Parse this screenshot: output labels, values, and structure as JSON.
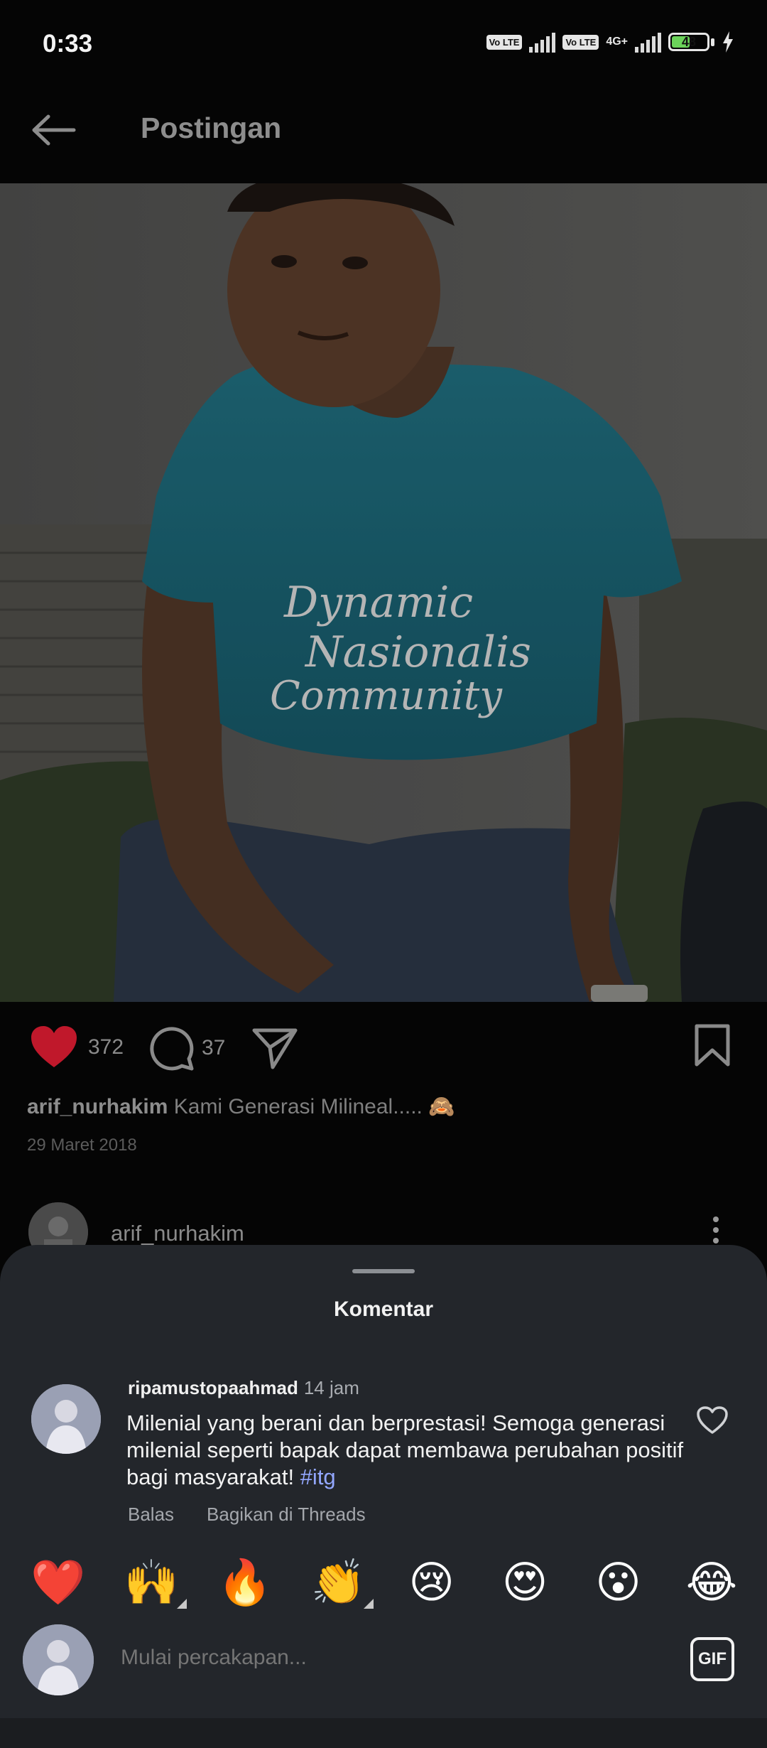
{
  "status_bar": {
    "time": "0:33",
    "volte_1": "Vo LTE",
    "volte_2": "Vo LTE",
    "network": "4G+",
    "battery": "48"
  },
  "header": {
    "title": "Postingan",
    "back_icon": "back-arrow-icon"
  },
  "post": {
    "photo_print_line1": "Dynamic",
    "photo_print_line2": "Nasionalis",
    "photo_print_line3": "Community",
    "likes": "372",
    "comments": "37",
    "caption_user": "arif_nurhakim",
    "caption_text": "Kami Generasi Milineal..... 🙈",
    "date": "29 Maret 2018",
    "author_row_name": "arif_nurhakim"
  },
  "comments_sheet": {
    "title": "Komentar",
    "comment": {
      "user": "ripamustopaahmad",
      "time": "14 jam",
      "text": "Milenial yang berani dan berprestasi! Semoga generasi milenial seperti bapak dapat membawa perubahan positif bagi masyarakat!",
      "hashtag": "#itg",
      "reply_label": "Balas",
      "share_label": "Bagikan di Threads"
    },
    "quick_emojis": [
      "❤️",
      "🙌",
      "🔥",
      "👏",
      "😢",
      "😍",
      "😮",
      "😂"
    ],
    "composer_placeholder": "Mulai percakapan...",
    "gif_label": "GIF"
  },
  "colors": {
    "background": "#050505",
    "sheet": "#23262b",
    "like_red": "#c0182b",
    "hashtag": "#93a7ff"
  }
}
